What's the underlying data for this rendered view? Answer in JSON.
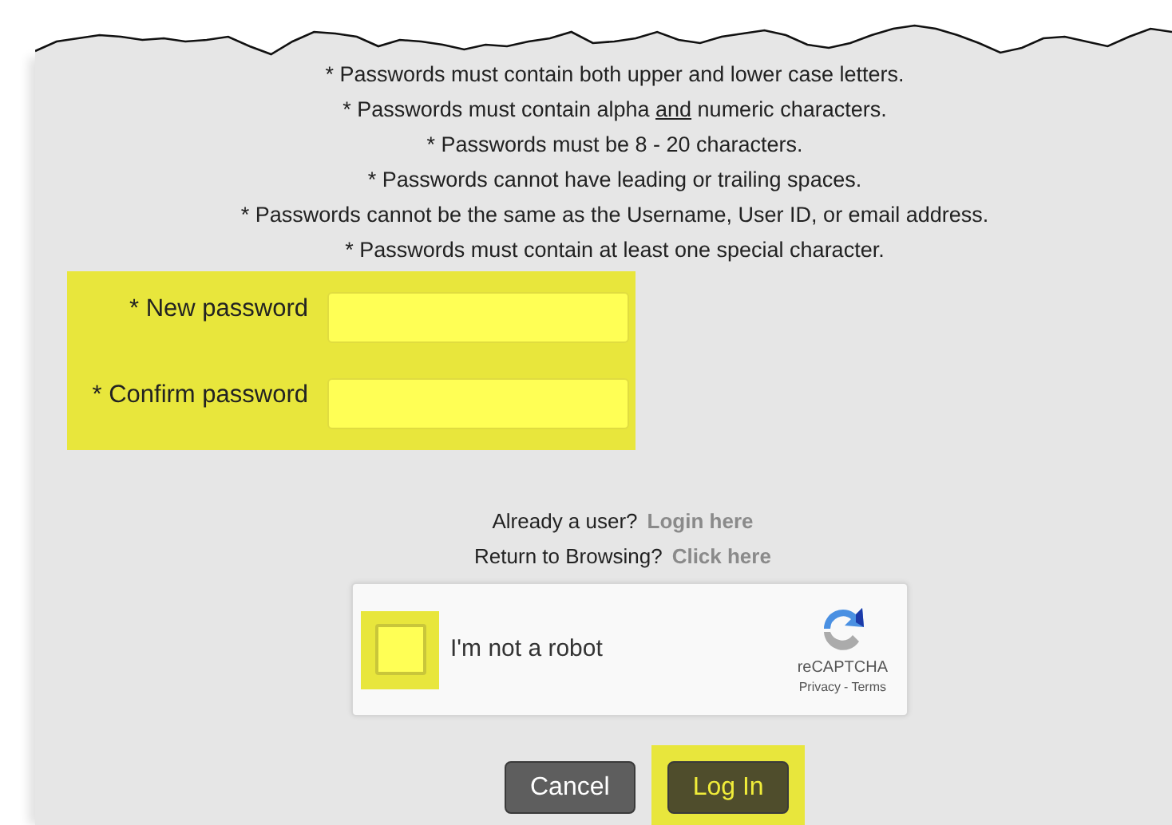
{
  "rules": [
    [
      {
        "text": "* Passwords must contain both upper and lower case letters.",
        "underline": false
      }
    ],
    [
      {
        "text": "* Passwords must contain alpha ",
        "underline": false
      },
      {
        "text": "and",
        "underline": true
      },
      {
        "text": " numeric characters.",
        "underline": false
      }
    ],
    [
      {
        "text": "* Passwords must be 8 - 20 characters.",
        "underline": false
      }
    ],
    [
      {
        "text": "* Passwords cannot have leading or trailing spaces.",
        "underline": false
      }
    ],
    [
      {
        "text": "* Passwords cannot be the same as the Username, User ID, or email address.",
        "underline": false
      }
    ],
    [
      {
        "text": "* Passwords must contain at least one special character.",
        "underline": false
      }
    ]
  ],
  "fields_highlighted": true,
  "fields": [
    {
      "label": "* New password"
    },
    {
      "label": "* Confirm password"
    }
  ],
  "links": [
    {
      "prompt": "Already a user?",
      "link": "Login here"
    },
    {
      "prompt": "Return to Browsing?",
      "link": "Click here"
    }
  ],
  "captcha": {
    "label": "I'm not a robot",
    "checked": false,
    "highlighted": true,
    "brand": "reCAPTCHA",
    "privacy": "Privacy",
    "separator": "-",
    "terms": "Terms"
  },
  "buttons": [
    {
      "label": "Cancel",
      "kind": "secondary",
      "highlighted": false
    },
    {
      "label": "Log In",
      "kind": "primary",
      "highlighted": true
    }
  ]
}
